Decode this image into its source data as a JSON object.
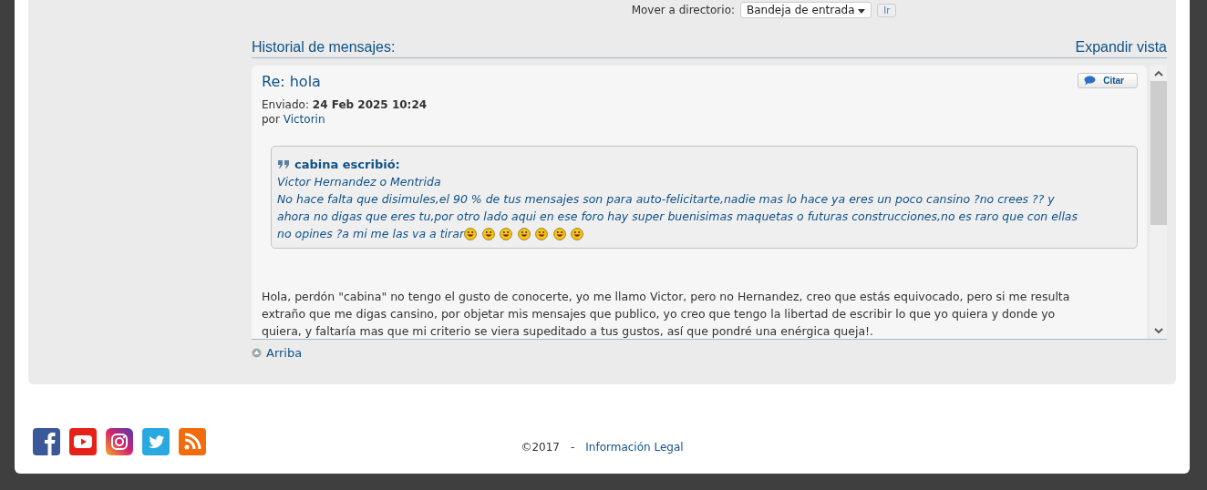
{
  "move_bar": {
    "label": "Mover a directorio:",
    "folder": "Bandeja de entrada",
    "go_button": "Ir"
  },
  "history": {
    "title": "Historial de mensajes:",
    "expand_link": "Expandir vista"
  },
  "message": {
    "subject": "Re: hola",
    "sent_label": "Enviado:",
    "sent_date": "24 Feb 2025 10:24",
    "by_label": "por",
    "author": "Victorin",
    "quote_button": "Citar",
    "quote": {
      "header": "cabina escribió:",
      "lines": [
        "Victor Hernandez o Mentrida",
        "No hace falta que disimules,el 90 % de tus mensajes son para auto-felicitarte,nadie mas lo hace ya eres un poco cansino ?no crees ?? y",
        "ahora no digas que eres tu,por otro lado aqui en ese foro hay super buenisimas maquetas o futuras construcciones,no es raro que con ellas",
        "no opines ?a mi me las va a tirar"
      ]
    },
    "body": "Hola, perdón \"cabina\" no tengo el gusto de conocerte, yo me llamo Victor, pero no Hernandez, creo que estás equivocado, pero si me resulta extraño que me digas cansino, por objetar mis mensajes que publico, yo creo que tengo la libertad de escribir lo que yo quiera y donde yo quiera, y faltaría mas que mi criterio se viera supeditado a tus gustos, así que pondré una enérgica queja!."
  },
  "top_link": "Arriba",
  "footer": {
    "copyright": "©2017",
    "separator": "-",
    "legal_link": "Información Legal"
  }
}
